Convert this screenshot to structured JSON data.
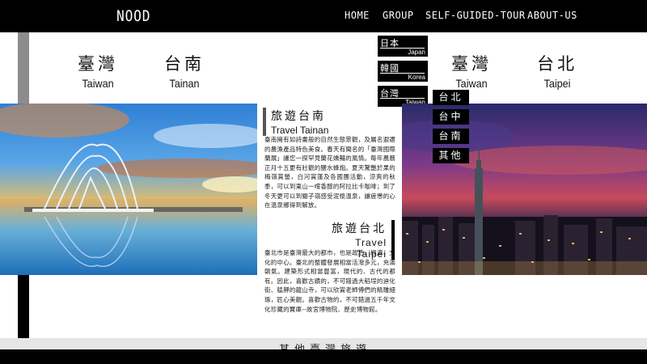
{
  "brand": {
    "logo": "NOOD"
  },
  "nav": [
    "HOME",
    "GROUP",
    "SELF-GUIDED-TOUR",
    "ABOUT-US"
  ],
  "cities": [
    {
      "zh": "臺灣",
      "en": "Taiwan"
    },
    {
      "zh": "台南",
      "en": "Tainan"
    },
    {
      "zh": "臺灣",
      "en": "Taiwan"
    },
    {
      "zh": "台北",
      "en": "Taipei"
    }
  ],
  "languages": [
    {
      "zh": "日本",
      "en": "Japan"
    },
    {
      "zh": "韓國",
      "en": "Korea"
    },
    {
      "zh": "台灣",
      "en": "Taiwan"
    }
  ],
  "city_menu": [
    "台北",
    "台中",
    "台南",
    "其他"
  ],
  "article": {
    "section_a": {
      "title_zh": "旅遊台南",
      "title_en": "Travel Tainan",
      "body": "臺南擁有如詩畫般的自然生態景觀，及屬名遐邇的農漁產品特色美食。春天有聞名的「臺灣國際蘭展」讓您一探罕見蘭花嬌豔的風情。每年農曆正月十五更有壯觀的鹽水蜂炮。夏天驚艷於果的梅嶺賞螢，白河賞蓮及各國團活動，涼爽的秋季，可以到東山一嚐香醇的阿拉比卡咖啡；到了冬天更可以到關子嶺感受泥漿溫泉，讓疲憊的心在溫泉鄉得到解放。"
    },
    "section_b": {
      "title_zh": "旅遊台北",
      "title_en": "Travel Taipei",
      "body": "臺北市是臺灣最大的都市，也是政治、經濟、文化的中心。臺北的整體發展相當活潑多元，充滿朝氣。建築形式相當豐富，現代的、古代的都有。因此，喜歡古蹟的，不可錯過大稻埕的迪化街、艋舺的龍山寺，可以欣賞老師傅們的精雕細琢，匠心美觀。喜歡古物的，不可錯過五千年文化珍藏的寶庫--故宮博物院、歷史博物館。"
    }
  },
  "bottom": {
    "title": "其他臺灣旅遊"
  },
  "colors": {
    "nav_bg": "#000000",
    "rail_gray": "#8c8c8c",
    "page_bg": "#ffffff"
  }
}
